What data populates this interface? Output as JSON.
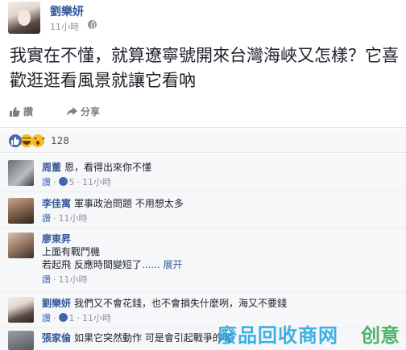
{
  "post": {
    "author": "劉樂妍",
    "time": "11小時",
    "text": "我實在不懂，就算遼寧號開來台灣海峽又怎樣？它喜歡逛逛看風景就讓它看吶"
  },
  "actions": {
    "like_label": "讚",
    "share_label": "分享"
  },
  "reactions": {
    "count": "128"
  },
  "comments": [
    {
      "name": "周董",
      "text": "恩，看得出來你不懂",
      "like_label": "讚",
      "likes": "5",
      "time": "11小時"
    },
    {
      "name": "李佳寓",
      "text": "軍事政治問題 不用想太多",
      "like_label": "讚",
      "time": "11小時"
    },
    {
      "name": "廖東昇",
      "line1": "上面有戰鬥機",
      "line2": "若起飛 反應時間變短了",
      "more": "...... 展开",
      "like_label": "讚",
      "time": "11小時"
    },
    {
      "name": "劉樂妍",
      "text": "我們又不會花錢，也不會損失什麼咧，海又不要錢",
      "like_label": "讚",
      "likes": "1",
      "time": "11小時"
    },
    {
      "name": "張家倫",
      "text": "如果它突然動作 可是會引起戰爭的呢"
    }
  ],
  "watermark": {
    "text": "廢品回收商网",
    "brand": "创意"
  },
  "colors": {
    "name_blue": "#365899",
    "facebook_blue": "#4267b2",
    "meta_gray": "#90949c",
    "comment_bg": "#f6f7f9",
    "reaction_yellow": "#f7b928"
  }
}
